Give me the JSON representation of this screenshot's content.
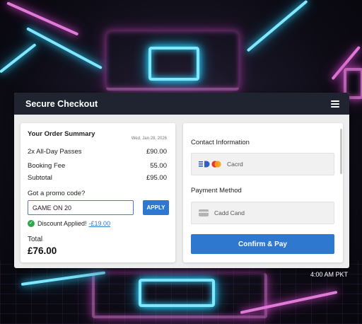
{
  "window": {
    "title": "Secure Checkout"
  },
  "order_summary": {
    "heading": "Your Order Summary",
    "date": "Wed, Jan 28, 2026",
    "items": [
      {
        "label": "2x All-Day Passes",
        "value": "£90.00"
      },
      {
        "label": "Booking Fee",
        "value": "55.00"
      },
      {
        "label": "Subtotal",
        "value": "£95.00"
      }
    ],
    "promo": {
      "label": "Got a promo code?",
      "input_value": "GAME ON 20",
      "apply_label": "APPLY",
      "discount_text": "Discount Applied!",
      "discount_amount": "-£19.00"
    },
    "total_label": "Total",
    "total_value": "£76.00"
  },
  "checkout": {
    "contact_title": "Contact Information",
    "contact_method_text": "Cacrd",
    "payment_title": "Payment Method",
    "payment_method_text": "Cadd Cand",
    "confirm_label": "Confirm & Pay"
  },
  "status": {
    "clock": "4:00 AM PKT"
  },
  "colors": {
    "accent": "#2f78d0",
    "titlebar": "#1f2430",
    "success": "#2ea84f"
  }
}
